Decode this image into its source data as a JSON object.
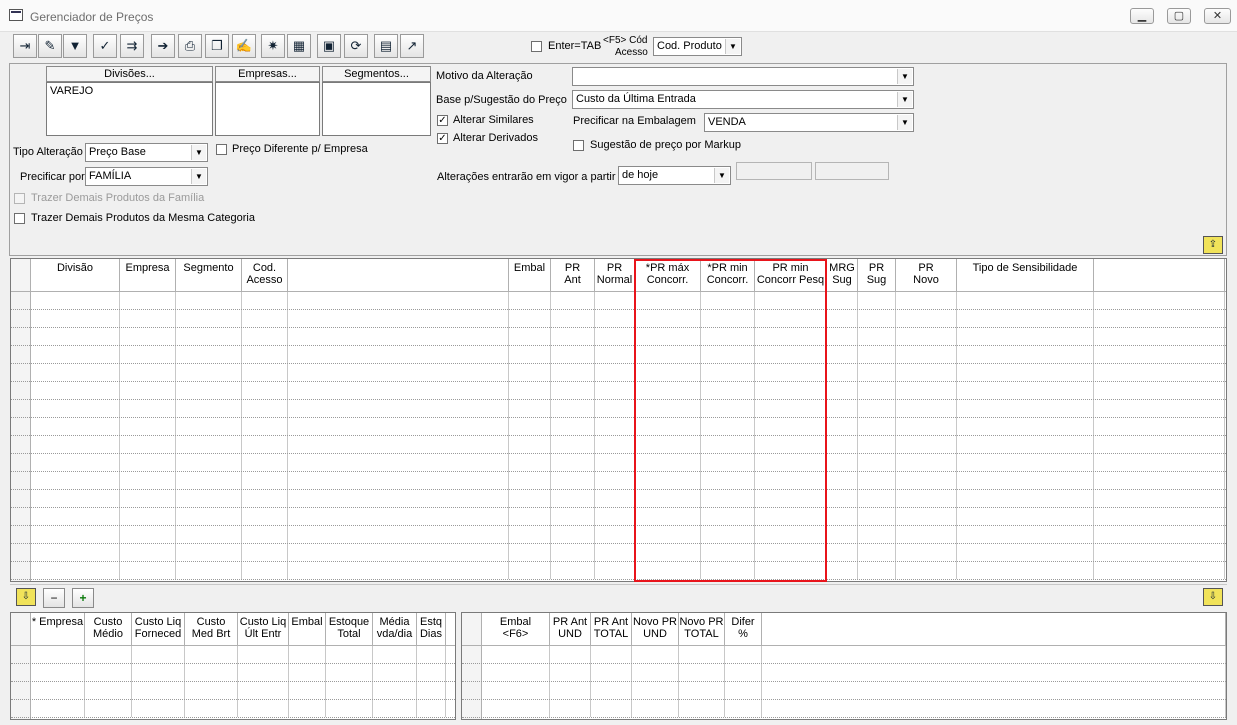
{
  "window": {
    "title": "Gerenciador de Preços"
  },
  "toolbar": {
    "buttons": [
      {
        "icon": "exit-door-icon"
      },
      {
        "icon": "eraser-icon"
      },
      {
        "icon": "filter-icon"
      },
      {
        "icon": "filter-check-icon"
      },
      {
        "icon": "arrow-grid-icon"
      },
      {
        "icon": "export-arrow-icon"
      },
      {
        "icon": "printer-icon"
      },
      {
        "icon": "copy-print-icon"
      },
      {
        "icon": "edit-check-icon"
      },
      {
        "icon": "sparkle-grid-icon"
      },
      {
        "icon": "table-icon"
      },
      {
        "icon": "save-disk-icon"
      },
      {
        "icon": "refresh-icon"
      },
      {
        "icon": "calculator-icon"
      },
      {
        "icon": "chart-icon"
      }
    ],
    "enter_tab_label": "Enter=TAB",
    "f5_label_1": "<F5> Cód",
    "f5_label_2": "Acesso",
    "code_select": "Cod. Produto"
  },
  "filters": {
    "divisoes_label": "Divisões...",
    "empresas_label": "Empresas...",
    "segmentos_label": "Segmentos...",
    "divisoes_items": [
      "VAREJO"
    ],
    "tipo_alteracao_label": "Tipo Alteração",
    "tipo_alteracao_value": "Preço Base",
    "preco_diferente_label": "Preço Diferente p/ Empresa",
    "precificar_por_label": "Precificar por",
    "precificar_por_value": "FAMÍLIA",
    "trazer_familia_label": "Trazer Demais Produtos da Família",
    "trazer_categoria_label": "Trazer Demais Produtos da Mesma Categoria"
  },
  "options": {
    "motivo_label": "Motivo da Alteração",
    "motivo_value": "",
    "base_label": "Base p/Sugestão do Preço",
    "base_value": "Custo da Última Entrada",
    "alterar_similares_label": "Alterar Similares",
    "alterar_derivados_label": "Alterar Derivados",
    "precificar_embalagem_label": "Precificar na Embalagem",
    "embalagem_value": "VENDA",
    "sugestao_markup_label": "Sugestão de preço por Markup",
    "vigor_label": "Alterações entrarão em vigor a partir",
    "vigor_value": "de hoje"
  },
  "main_grid": {
    "columns": [
      "Divisão",
      "Empresa",
      "Segmento",
      "Cod.\nAcesso",
      "",
      "Embal",
      "PR\nAnt",
      "PR\nNormal",
      "*PR máx\nConcorr.",
      "*PR min\nConcorr.",
      "PR min\nConcorr Pesq",
      "MRG\nSug",
      "PR Sug",
      "PR\nNovo",
      "Tipo de Sensibilidade",
      ""
    ]
  },
  "bottom_left_grid": {
    "columns": [
      "* Empresa",
      "Custo\nMédio",
      "Custo Liq\nForneced",
      "Custo\nMed Brt",
      "Custo Liq\nÚlt Entr",
      "Embal",
      "Estoque\nTotal",
      "Média\nvda/dia",
      "Estq\nDias"
    ]
  },
  "bottom_right_grid": {
    "columns": [
      "Embal\n<F6>",
      "PR Ant\nUND",
      "PR Ant\nTOTAL",
      "Novo PR\nUND",
      "Novo PR\nTOTAL",
      "Difer\n%",
      ""
    ]
  },
  "colors": {
    "highlight": "#e8141b"
  }
}
